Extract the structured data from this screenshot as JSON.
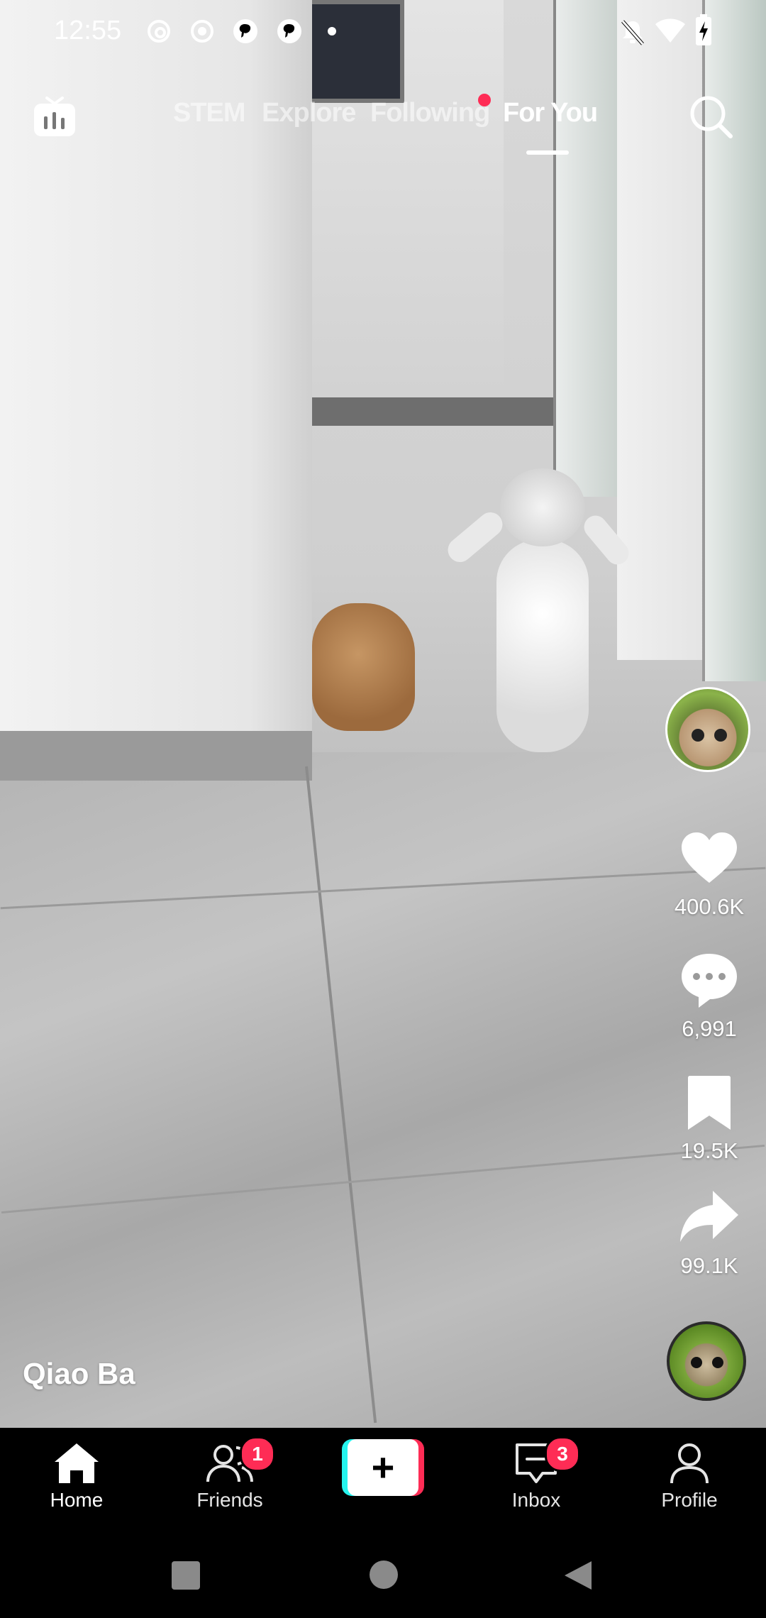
{
  "status_bar": {
    "time": "12:55",
    "notification_icons": [
      "threads-icon",
      "record-icon",
      "pinterest-icon",
      "pinterest-icon",
      "dot-icon"
    ],
    "system_icons": [
      "bell-off-icon",
      "wifi-icon",
      "battery-charging-icon"
    ]
  },
  "top_nav": {
    "tabs": [
      {
        "label": "STEM",
        "active": false
      },
      {
        "label": "Explore",
        "active": false
      },
      {
        "label": "Following",
        "active": false,
        "has_notification_dot": true
      },
      {
        "label": "For You",
        "active": true
      }
    ],
    "live_icon": "tv-live-icon",
    "search_icon": "search-icon"
  },
  "video": {
    "author_name": "Qiao Ba"
  },
  "actions": {
    "likes": "400.6K",
    "comments": "6,991",
    "saves": "19.5K",
    "shares": "99.1K"
  },
  "bottom_nav": {
    "items": [
      {
        "label": "Home",
        "icon": "home-icon",
        "active": true
      },
      {
        "label": "Friends",
        "icon": "friends-icon",
        "badge": "1"
      },
      {
        "label": "",
        "icon": "create-plus-icon"
      },
      {
        "label": "Inbox",
        "icon": "inbox-icon",
        "badge": "3"
      },
      {
        "label": "Profile",
        "icon": "profile-icon"
      }
    ]
  },
  "colors": {
    "accent": "#fe2c55",
    "cyan": "#25f4ee",
    "background": "#000000"
  }
}
